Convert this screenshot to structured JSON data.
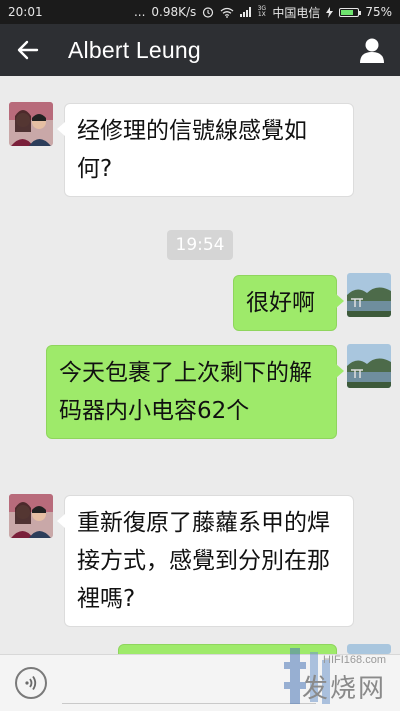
{
  "status_bar": {
    "time": "20:01",
    "dots": "...",
    "speed": "0.98K/s",
    "network_gen": "3G\n1X",
    "carrier": "中国电信",
    "battery": "75%",
    "battery_level": 0.75
  },
  "header": {
    "title": "Albert Leung",
    "back_icon": "back-arrow-icon",
    "profile_icon": "person-icon"
  },
  "messages": [
    {
      "side": "in",
      "text": "经修理的信號線感覺如何?"
    },
    {
      "type": "time",
      "text": "19:54"
    },
    {
      "side": "out",
      "text": "很好啊"
    },
    {
      "side": "out",
      "text": "今天包裹了上次剩下的解码器内小电容62个"
    },
    {
      "side": "in",
      "text": "重新復原了藤蘿系甲的焊接方式，感覺到分別在那裡嗎?"
    }
  ],
  "input_bar": {
    "voice_icon": "voice-icon",
    "input_value": ""
  },
  "watermark": {
    "url": "HIFI168.com",
    "text": "发烧网"
  },
  "colors": {
    "titlebar": "#2d2f33",
    "statusbar": "#1b1b1b",
    "chat_bg": "#ebebeb",
    "bubble_out": "#9eea6a",
    "bubble_in": "#ffffff"
  }
}
